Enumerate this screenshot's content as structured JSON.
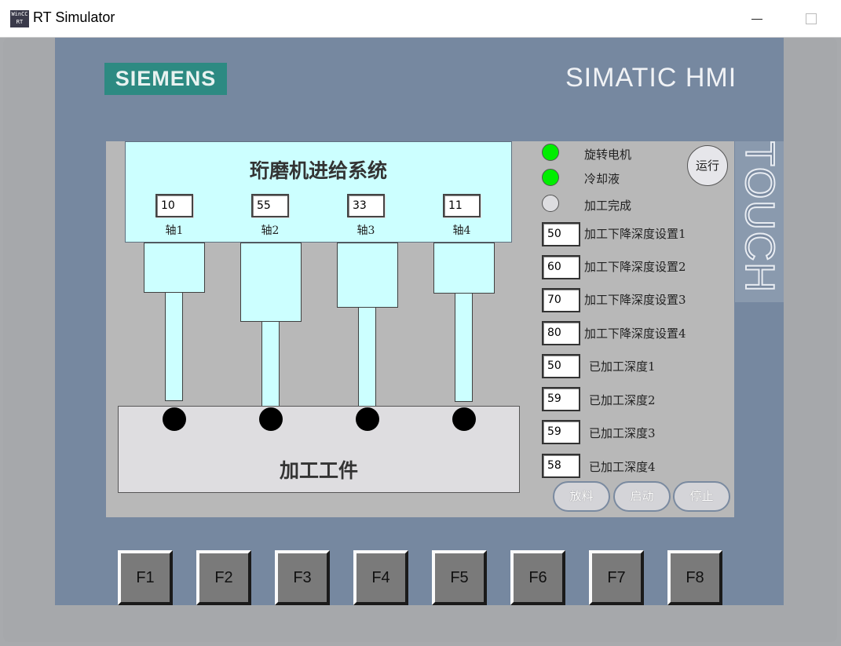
{
  "window": {
    "title": "RT Simulator",
    "icon": "wincc-rt-icon",
    "icon_text": "WinCC RT"
  },
  "hmi": {
    "brand": "SIEMENS",
    "model": "SIMATIC HMI",
    "touch": "TOUCH"
  },
  "screen": {
    "title": "珩磨机进给系统",
    "axes": [
      {
        "value": "10",
        "label": "轴1"
      },
      {
        "value": "55",
        "label": "轴2"
      },
      {
        "value": "33",
        "label": "轴3"
      },
      {
        "value": "11",
        "label": "轴4"
      }
    ],
    "workpiece": "加工工件",
    "indicators": [
      {
        "label": "旋转电机",
        "state": "on",
        "color": "#00ee00"
      },
      {
        "label": "冷却液",
        "state": "on",
        "color": "#00ee00"
      },
      {
        "label": "加工完成",
        "state": "off",
        "color": "#dddde0"
      }
    ],
    "run_button": "运行",
    "setpoints": [
      {
        "value": "50",
        "label": "加工下降深度设置1"
      },
      {
        "value": "60",
        "label": "加工下降深度设置2"
      },
      {
        "value": "70",
        "label": "加工下降深度设置3"
      },
      {
        "value": "80",
        "label": "加工下降深度设置4"
      }
    ],
    "actuals": [
      {
        "value": "50",
        "label": "已加工深度1"
      },
      {
        "value": "59",
        "label": "已加工深度2"
      },
      {
        "value": "59",
        "label": "已加工深度3"
      },
      {
        "value": "58",
        "label": "已加工深度4"
      }
    ],
    "buttons": {
      "discharge": "放料",
      "start": "启动",
      "stop": "停止"
    }
  },
  "function_keys": [
    "F1",
    "F2",
    "F3",
    "F4",
    "F5",
    "F6",
    "F7",
    "F8"
  ],
  "colors": {
    "panel": "#7688a0",
    "brand": "#2d8a82",
    "cylinder": "#ccffff",
    "lamp_on": "#00ee00"
  }
}
